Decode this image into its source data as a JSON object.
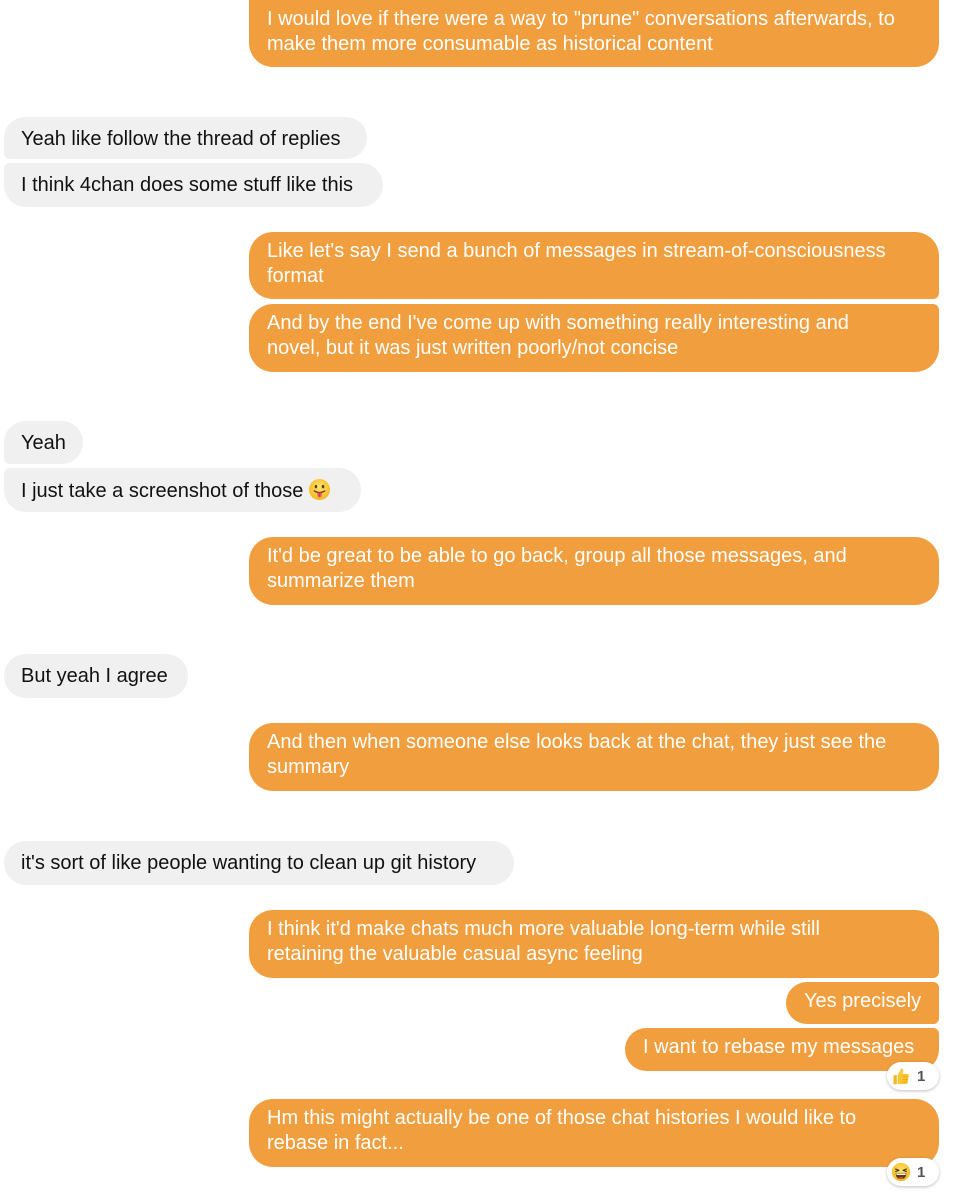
{
  "conversation": {
    "colors": {
      "outgoing_bubble": "#f09e3e",
      "outgoing_text": "#ffffff",
      "incoming_bubble": "#f0f0f0",
      "incoming_text": "#111111"
    },
    "messages": [
      {
        "direction": "outgoing",
        "lines": [
          "I would love if there were a way to \"prune\" conversations afterwards, to",
          "make them more consumable as historical content"
        ]
      },
      {
        "direction": "incoming",
        "lines": [
          "Yeah like follow the thread of replies"
        ]
      },
      {
        "direction": "incoming",
        "lines": [
          "I think 4chan does some stuff like this"
        ]
      },
      {
        "direction": "outgoing",
        "lines": [
          "Like let's say I send a bunch of messages in stream-of-consciousness",
          "format"
        ]
      },
      {
        "direction": "outgoing",
        "lines": [
          "And by the end I've come up with something really interesting and",
          "novel, but it was just written poorly/not concise"
        ]
      },
      {
        "direction": "incoming",
        "lines": [
          "Yeah"
        ]
      },
      {
        "direction": "incoming",
        "lines": [
          "I just take a screenshot of those"
        ],
        "emoji": "tongue-out-face-emoji"
      },
      {
        "direction": "outgoing",
        "lines": [
          "It'd be great to be able to go back, group all those messages, and",
          "summarize them"
        ]
      },
      {
        "direction": "incoming",
        "lines": [
          "But yeah I agree"
        ]
      },
      {
        "direction": "outgoing",
        "lines": [
          "And then when someone else looks back at the chat, they just see the",
          "summary"
        ]
      },
      {
        "direction": "incoming",
        "lines": [
          "it's sort of like people wanting to clean up git history"
        ]
      },
      {
        "direction": "outgoing",
        "lines": [
          "I think it'd make chats much more valuable long-term while still",
          "retaining the valuable casual async feeling"
        ]
      },
      {
        "direction": "outgoing",
        "lines": [
          "Yes precisely"
        ]
      },
      {
        "direction": "outgoing",
        "lines": [
          "I want to rebase my messages"
        ],
        "reaction": {
          "icon": "thumbs-up-emoji",
          "count": "1"
        }
      },
      {
        "direction": "outgoing",
        "lines": [
          "Hm this might actually be one of those chat histories I would like to",
          "rebase in fact..."
        ],
        "reaction": {
          "icon": "laughing-face-emoji",
          "count": "1"
        }
      }
    ]
  }
}
